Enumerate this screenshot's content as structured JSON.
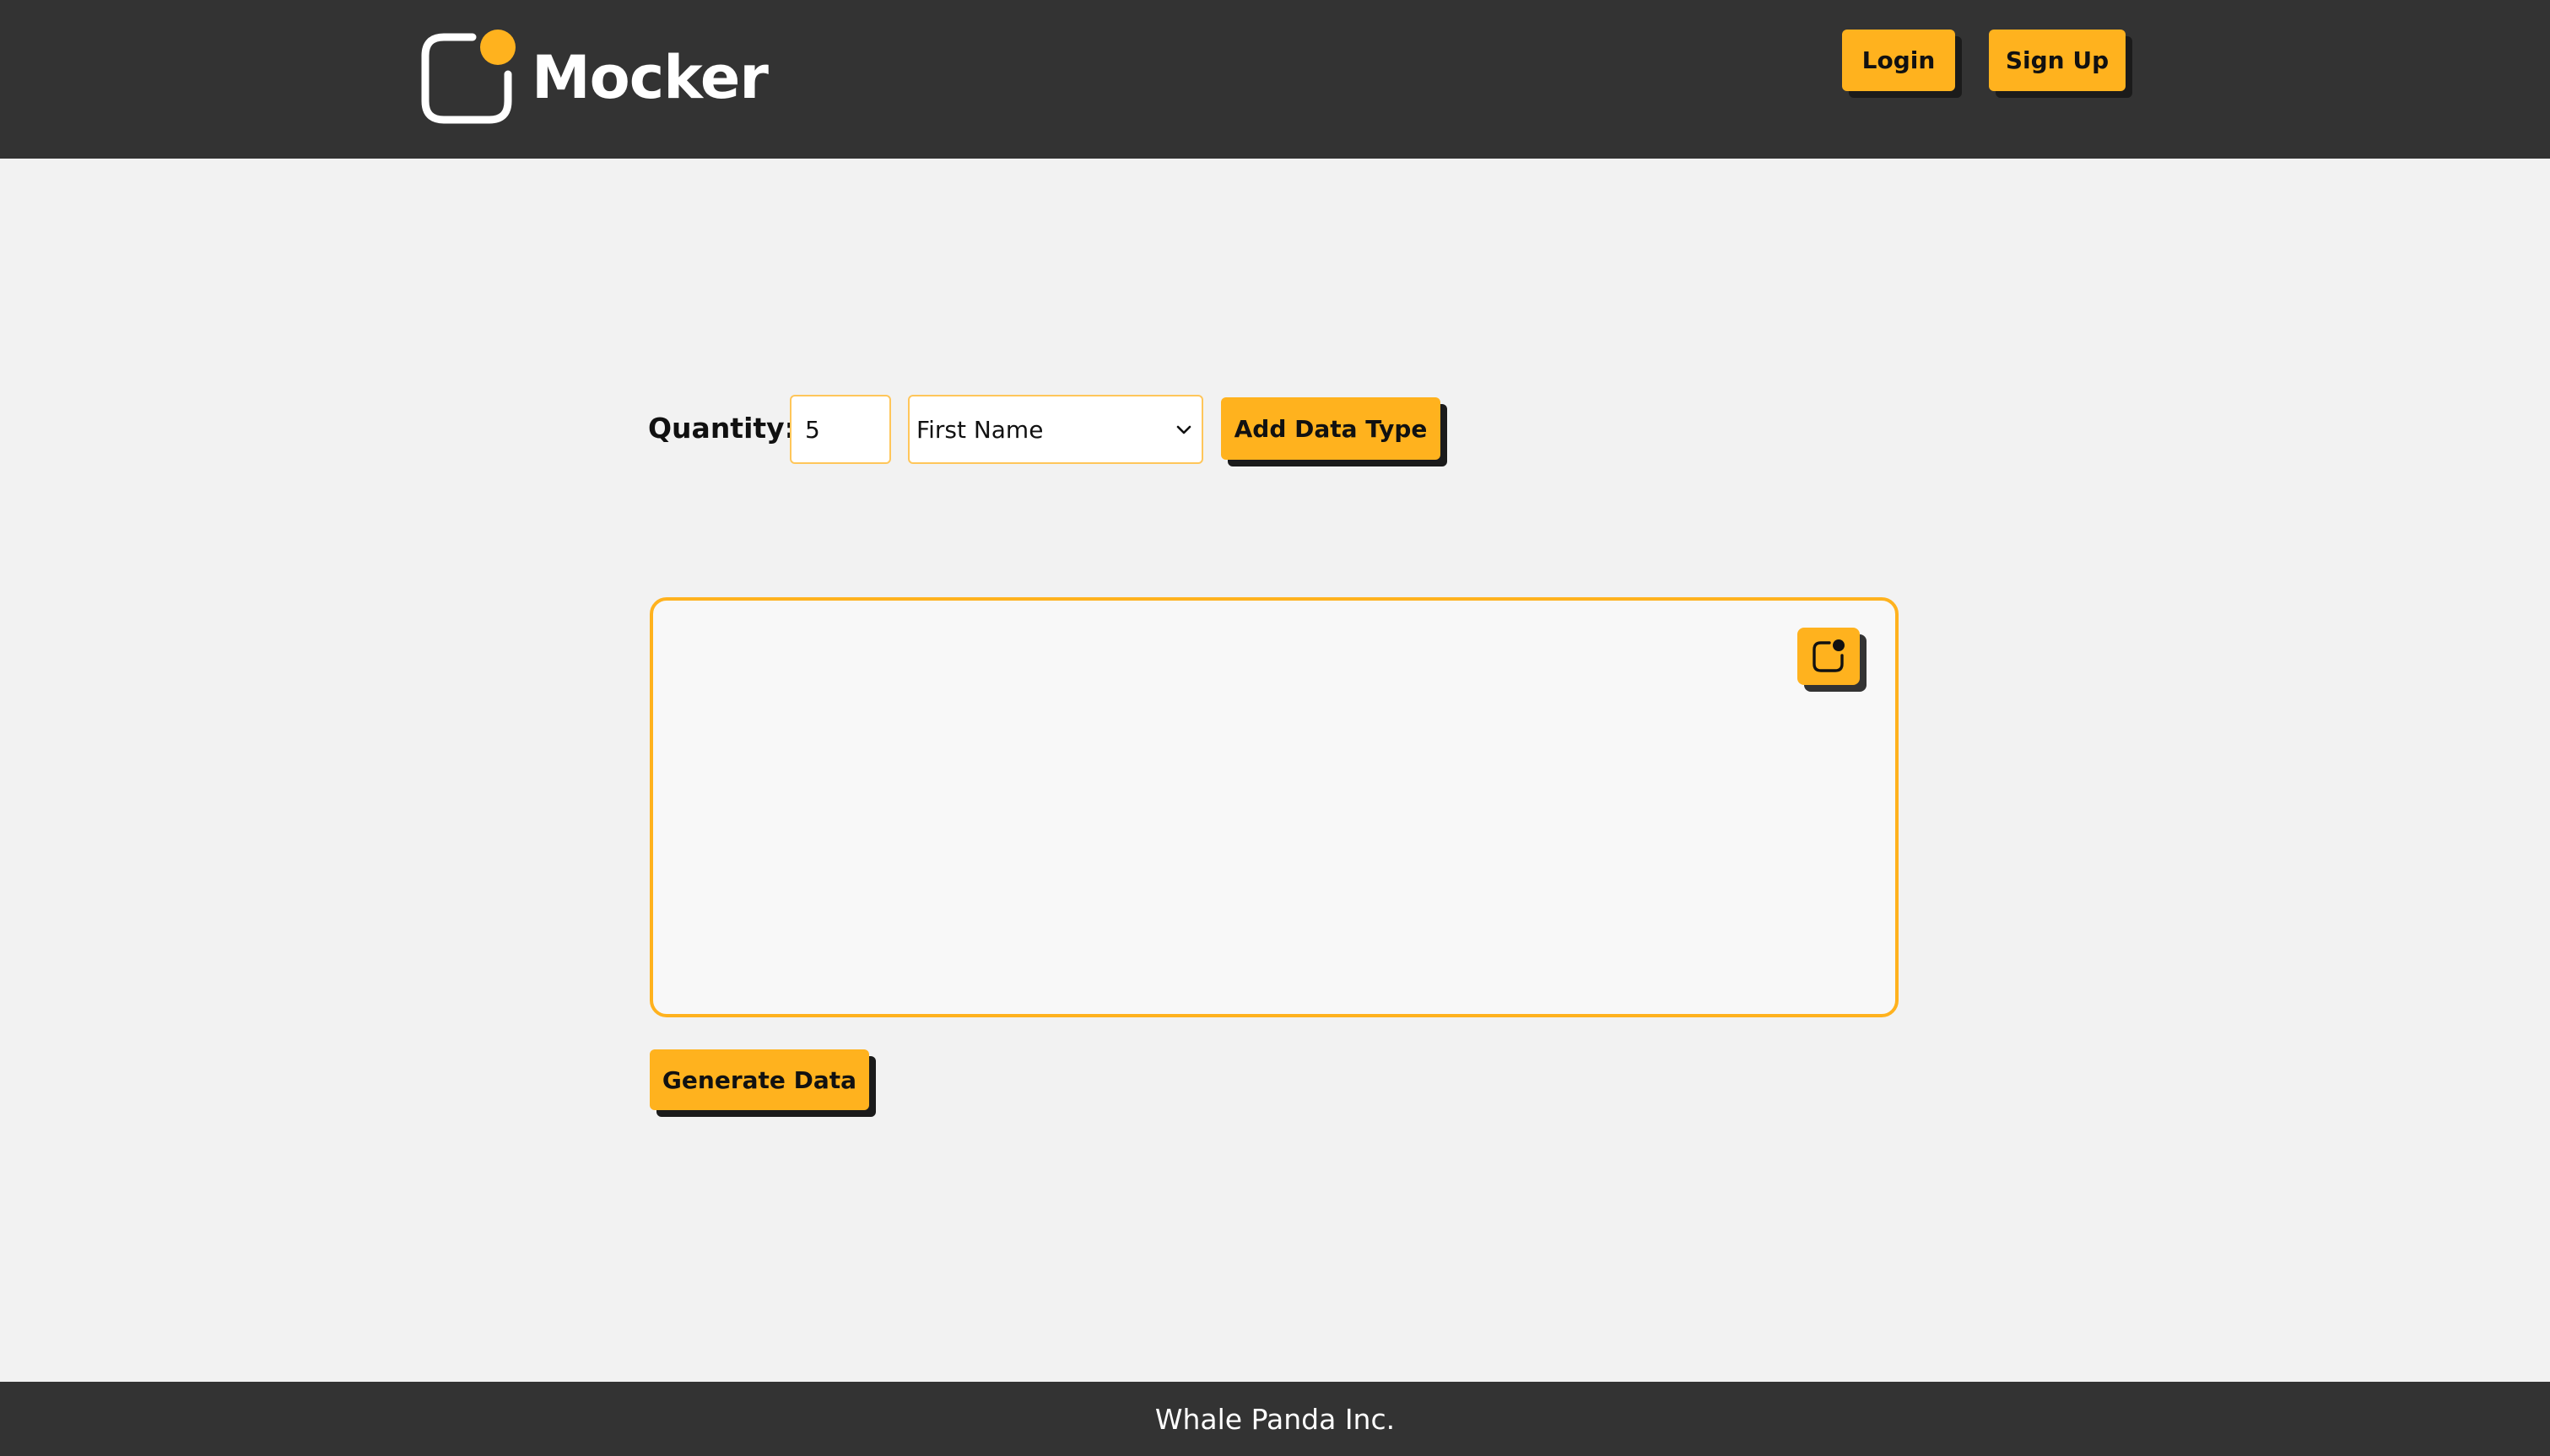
{
  "app": {
    "name": "Mocker"
  },
  "header": {
    "login_label": "Login",
    "signup_label": "Sign Up"
  },
  "controls": {
    "quantity_label": "Quantity:",
    "quantity_value": "5",
    "data_type_selected": "First Name",
    "add_button_label": "Add Data Type"
  },
  "output": {
    "content": ""
  },
  "actions": {
    "generate_label": "Generate Data"
  },
  "footer": {
    "text": "Whale Panda Inc."
  },
  "icons": {
    "logo": "mocker-logo-icon",
    "copy": "copy-icon",
    "select_chevron": "chevron-down-icon"
  },
  "colors": {
    "accent": "#ffb21e",
    "header_bg": "#333333",
    "page_bg": "#f2f2f2",
    "output_bg": "#f8f8f8"
  }
}
